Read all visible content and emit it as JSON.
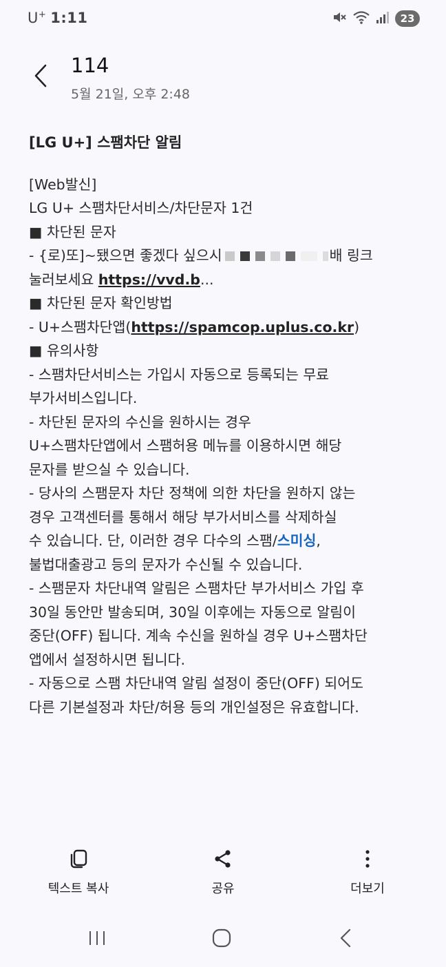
{
  "status_bar": {
    "carrier": "U",
    "carrier_plus": "+",
    "time": "1:11",
    "battery": "23",
    "icons": [
      "mute-icon",
      "wifi-icon",
      "signal-icon"
    ]
  },
  "header": {
    "sender": "114",
    "date": "5월 21일, 오후 2:48",
    "back_icon": "chevron-left-icon"
  },
  "message": {
    "title": "[LG U+] 스팸차단 알림",
    "lines": {
      "l1": "[Web발신]",
      "l2": "LG U+ 스팸차단서비스/차단문자 1건",
      "l3": "■ 차단된 문자",
      "l4a": " - {로)또]~됐으면 좋겠다 싶으시",
      "l4b": "배 링크",
      "l5a": "눌러보세요 ",
      "l5link": "https://vvd.b",
      "l5b": "...",
      "l6": "■ 차단된 문자 확인방법",
      "l7a": " - U+스팸차단앱(",
      "l7link": "https://spamcop.uplus.co.kr",
      "l7b": ")",
      "l8": "■ 유의사항",
      "l9": " - 스팸차단서비스는 가입시 자동으로 등록되는 무료",
      "l10": "부가서비스입니다.",
      "l11": " - 차단된 문자의 수신을 원하시는 경우",
      "l12": "U+스팸차단앱에서 스팸허용 메뉴를 이용하시면 해당",
      "l13": "문자를 받으실 수 있습니다.",
      "l14": " - 당사의 스팸문자 차단 정책에 의한 차단을 원하지 않는",
      "l15": "경우 고객센터를 통해서 해당 부가서비스를 삭제하실",
      "l16a": "수 있습니다. 단, 이러한 경우 다수의 스팸/",
      "l16link": "스미싱",
      "l16b": ",",
      "l17": "불법대출광고 등의 문자가 수신될 수 있습니다.",
      "l18": " - 스팸문자 차단내역 알림은 스팸차단 부가서비스 가입 후",
      "l19": "30일 동안만 발송되며, 30일 이후에는 자동으로 알림이",
      "l20": "중단(OFF) 됩니다. 계속 수신을 원하실 경우 U+스팸차단",
      "l21": "앱에서 설정하시면 됩니다.",
      "l22": " - 자동으로 스팸 차단내역 알림 설정이 중단(OFF) 되어도",
      "l23": "다른 기본설정과 차단/허용 등의 개인설정은 유효합니다."
    }
  },
  "actions": {
    "copy_text": "텍스트 복사",
    "share": "공유",
    "more": "더보기"
  },
  "colors": {
    "background": "#f9f8fc",
    "link_blue": "#1565c0",
    "text": "#2a2a2a"
  }
}
